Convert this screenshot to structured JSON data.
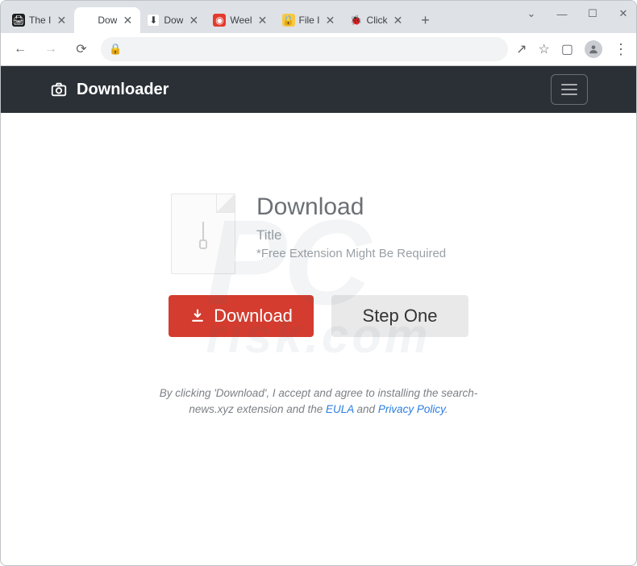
{
  "window": {
    "controls": {
      "chevron": "⌄",
      "min": "—",
      "max": "☐",
      "close": "✕"
    }
  },
  "tabs": [
    {
      "title": "The I",
      "favicon": "printer"
    },
    {
      "title": "Dow",
      "favicon": "blank",
      "active": true
    },
    {
      "title": "Dow",
      "favicon": "download"
    },
    {
      "title": "Weel",
      "favicon": "red-circle"
    },
    {
      "title": "File I",
      "favicon": "lock-yellow"
    },
    {
      "title": "Click",
      "favicon": "bug"
    }
  ],
  "toolbar": {
    "back": "←",
    "forward": "→",
    "reload": "⟳",
    "lock": "🔒",
    "share": "↗",
    "star": "☆",
    "panel": "▢",
    "avatar": "👤",
    "menu": "⋮"
  },
  "page": {
    "brand": "Downloader",
    "hamburger_label": "menu",
    "heading": "Download",
    "subtitle": "Title",
    "note": "*Free Extension Might Be Required",
    "download_btn": "Download",
    "step_btn": "Step One",
    "disclaimer_pre": "By clicking 'Download', I accept and agree to installing the search-news.xyz extension and the ",
    "eula": "EULA",
    "disclaimer_mid": " and ",
    "privacy": "Privacy Policy",
    "disclaimer_end": "."
  },
  "watermark": {
    "big": "PC",
    "small": "risk.com"
  }
}
